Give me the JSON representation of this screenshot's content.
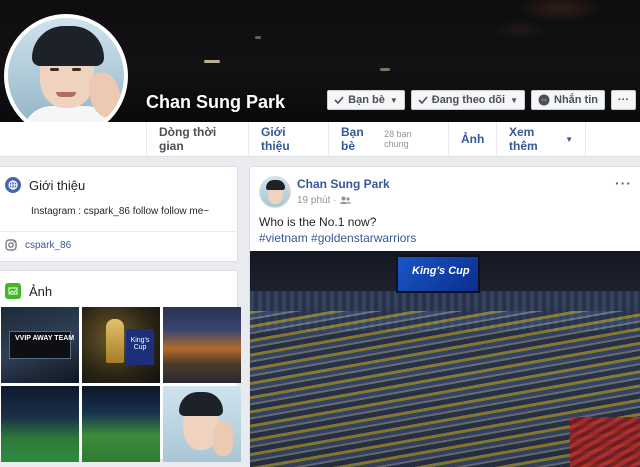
{
  "profile": {
    "name": "Chan Sung Park",
    "actions": {
      "friends": "Bạn bè",
      "following": "Đang theo dõi",
      "message": "Nhắn tin",
      "more": "···"
    }
  },
  "nav": {
    "timeline": "Dòng thời gian",
    "about": "Giới thiệu",
    "friends": "Bạn bè",
    "friends_sub": "28 bạn chung",
    "photos": "Ảnh",
    "more": "Xem thêm"
  },
  "intro": {
    "title": "Giới thiệu",
    "bio": "Instagram : cspark_86 follow follow me~",
    "instagram": "cspark_86"
  },
  "photos_card": {
    "title": "Ảnh",
    "thumb1_text": "VVIP AWAY TEAM",
    "thumb2_text": "King's Cup"
  },
  "post": {
    "author": "Chan Sung Park",
    "time": "19 phút ·",
    "text": "Who is the No.1 now?",
    "tags": "#vietnam #goldenstarwarriors",
    "menu": "···",
    "screen_text": "King's Cup"
  },
  "colors": {
    "link": "#365899",
    "intro_icon": "#4267b2",
    "photos_icon": "#42b72a"
  }
}
